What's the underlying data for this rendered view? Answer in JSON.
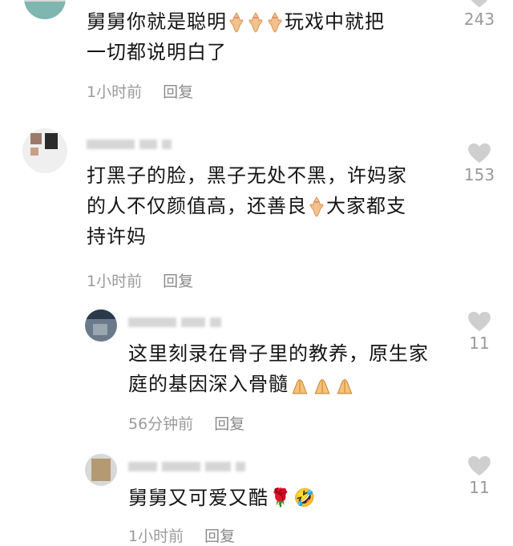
{
  "comments": [
    {
      "text_line1": "舅舅你就是聪明",
      "text_line1b": "玩戏中就把",
      "text_line2": "一切都说明白了",
      "time": "1小时前",
      "reply": "回复",
      "likes": "243",
      "emoji": "heart-hands-icon"
    },
    {
      "text_line1": "打黑子的脸，黑子无处不黑，许妈家",
      "text_line2a": "的人不仅颜值高，还善良",
      "text_line2b": "大家都支",
      "text_line3": "持许妈",
      "time": "1小时前",
      "reply": "回复",
      "likes": "153",
      "emoji": "heart-hands-icon"
    },
    {
      "text_line1": "这里刻录在骨子里的教养，原生家",
      "text_line2": "庭的基因深入骨髓",
      "time": "56分钟前",
      "reply": "回复",
      "likes": "11",
      "emoji": "praying-hands-icon"
    },
    {
      "text_line1": "舅舅又可爱又酷",
      "time": "1小时前",
      "reply": "回复",
      "likes": "11",
      "emoji": [
        "rose-icon",
        "laughing-face-icon"
      ]
    }
  ],
  "colors": {
    "text": "#141414",
    "meta": "#9a9a9a",
    "heart": "#cfcfcf"
  }
}
